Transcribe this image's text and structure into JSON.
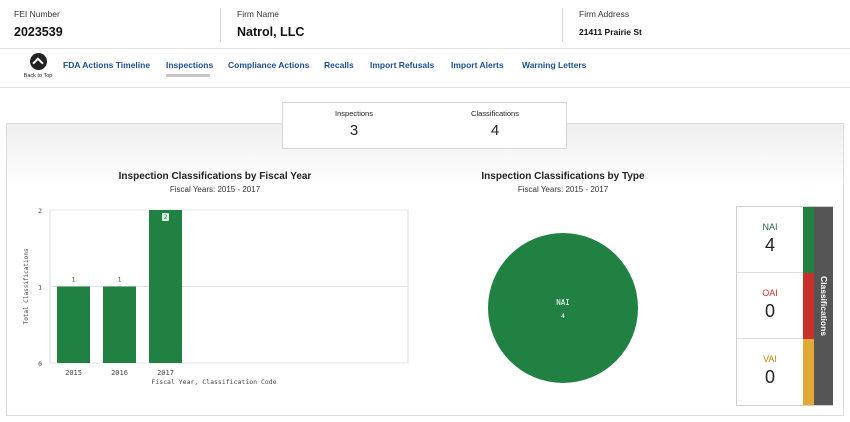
{
  "firm": {
    "fei_label": "FEI Number",
    "fei_value": "2023539",
    "name_label": "Firm Name",
    "name_value": "Natrol, LLC",
    "address_label": "Firm Address",
    "address_value": "21411 Prairie St"
  },
  "nav": {
    "back_to_top": "Back to Top",
    "items": [
      "FDA Actions Timeline",
      "Inspections",
      "Compliance Actions",
      "Recalls",
      "Import Refusals",
      "Import Alerts",
      "Warning Letters"
    ],
    "active": "Inspections"
  },
  "summary": {
    "inspections_label": "Inspections",
    "inspections_value": "3",
    "classifications_label": "Classifications",
    "classifications_value": "4"
  },
  "bar_chart": {
    "title": "Inspection Classifications by Fiscal Year",
    "subtitle": "Fiscal Years: 2015 - 2017",
    "xlabel": "Fiscal Year, Classification Code",
    "ylabel": "Total Classifications"
  },
  "pie_chart": {
    "title": "Inspection Classifications by Type",
    "subtitle": "Fiscal Years: 2015 - 2017"
  },
  "classifications": {
    "side_label": "Classifications",
    "items": [
      {
        "name": "NAI",
        "count": "4",
        "color": "#218143",
        "name_color": "#1e5f3a"
      },
      {
        "name": "OAI",
        "count": "0",
        "color": "#c9302c",
        "name_color": "#c9302c"
      },
      {
        "name": "VAI",
        "count": "0",
        "color": "#e3a937",
        "name_color": "#b8860b"
      }
    ]
  },
  "chart_data": [
    {
      "type": "bar",
      "title": "Inspection Classifications by Fiscal Year",
      "subtitle": "Fiscal Years: 2015 - 2017",
      "categories": [
        "2015",
        "2016",
        "2017"
      ],
      "values": [
        1,
        1,
        2
      ],
      "data_labels": [
        "1",
        "1",
        "2"
      ],
      "xlabel": "Fiscal Year, Classification Code",
      "ylabel": "Total Classifications",
      "ylim": [
        0,
        2
      ],
      "yticks": [
        0,
        1,
        2
      ],
      "color": "#218143",
      "grid": true
    },
    {
      "type": "pie",
      "title": "Inspection Classifications by Type",
      "subtitle": "Fiscal Years: 2015 - 2017",
      "labels": [
        "NAI"
      ],
      "values": [
        4
      ],
      "colors": [
        "#218143"
      ]
    }
  ]
}
